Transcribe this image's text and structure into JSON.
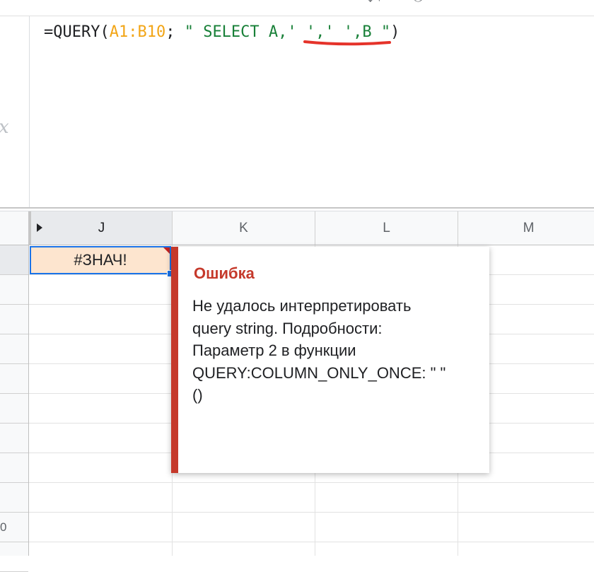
{
  "formula_bar": {
    "icon": "fx-icon",
    "formula_parts": [
      {
        "text": "=QUERY(",
        "kind": "plain"
      },
      {
        "text": "A1:B10",
        "kind": "range"
      },
      {
        "text": "; ",
        "kind": "plain"
      },
      {
        "text": "\" SELECT A,' ',' ',B \"",
        "kind": "string"
      },
      {
        "text": ")",
        "kind": "plain"
      }
    ],
    "annotation_color": "#e5332a"
  },
  "columns": [
    {
      "label": "J",
      "selected": true
    },
    {
      "label": "K",
      "selected": false
    },
    {
      "label": "L",
      "selected": false
    },
    {
      "label": "M",
      "selected": false
    }
  ],
  "rows": [
    {
      "label": "",
      "selected": true
    },
    {
      "label": "",
      "selected": false
    },
    {
      "label": "",
      "selected": false
    },
    {
      "label": "",
      "selected": false
    },
    {
      "label": "",
      "selected": false
    },
    {
      "label": "",
      "selected": false
    },
    {
      "label": "",
      "selected": false
    },
    {
      "label": "",
      "selected": false
    },
    {
      "label": "",
      "selected": false
    },
    {
      "label": "0",
      "selected": false
    },
    {
      "label": "",
      "selected": false
    }
  ],
  "active_cell": {
    "value": "#ЗНАЧ!",
    "background": "#fde5cf"
  },
  "error_tooltip": {
    "title": "Ошибка",
    "message_lines": [
      "Не удалось интерпретировать",
      "query string. Подробности:",
      "Параметр 2 в функции",
      "QUERY:COLUMN_ONLY_ONCE: \" \"",
      "()"
    ],
    "accent_color": "#c5392b"
  }
}
